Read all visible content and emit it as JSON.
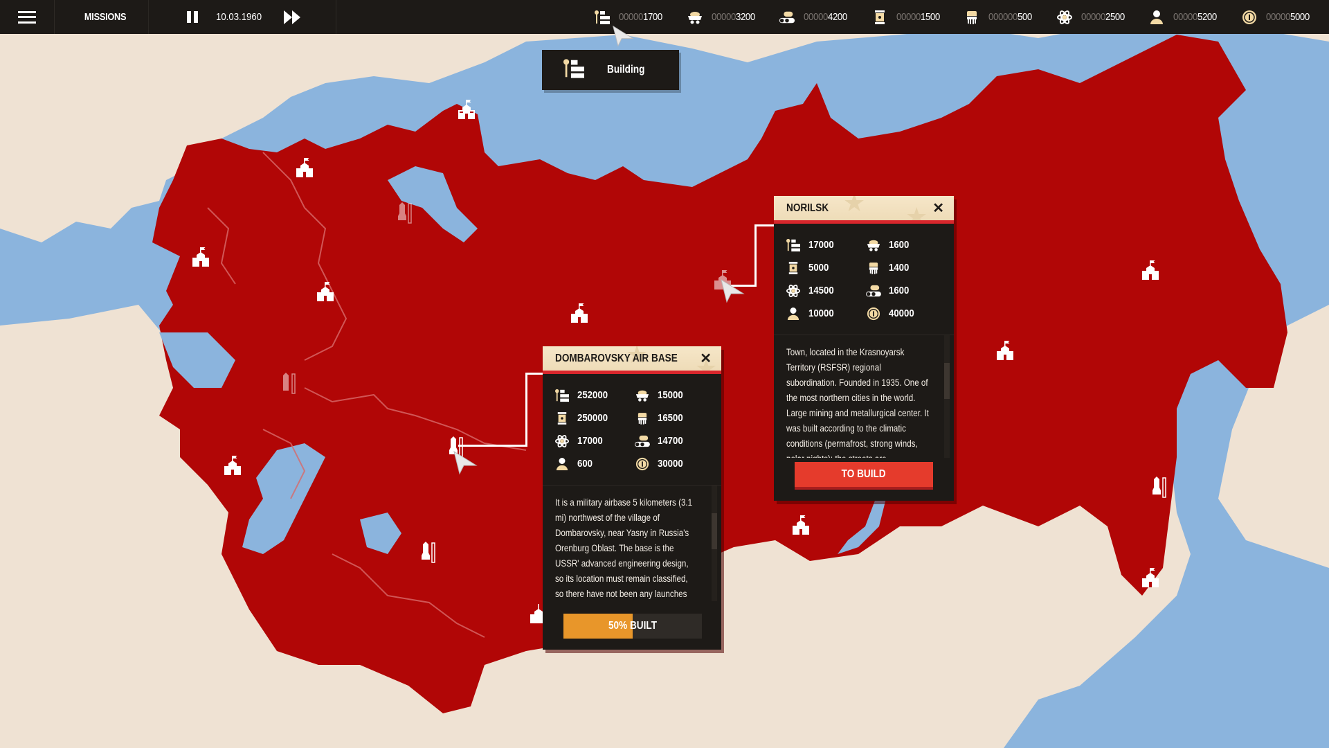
{
  "topbar": {
    "menu_icon": "hamburger-icon",
    "missions_label": "MISSIONS",
    "pause_icon": "pause-icon",
    "date": "10.03.1960",
    "fast_forward_icon": "fast-forward-icon"
  },
  "resources": [
    {
      "icon": "building-icon",
      "pad": "00000",
      "value": "1700"
    },
    {
      "icon": "ore-cart-icon",
      "pad": "00000",
      "value": "3200"
    },
    {
      "icon": "timber-icon",
      "pad": "00000",
      "value": "4200"
    },
    {
      "icon": "fuel-barrel-icon",
      "pad": "00000",
      "value": "1500"
    },
    {
      "icon": "engine-icon",
      "pad": "000000",
      "value": "500"
    },
    {
      "icon": "atom-icon",
      "pad": "00000",
      "value": "2500"
    },
    {
      "icon": "population-icon",
      "pad": "00000",
      "value": "5200"
    },
    {
      "icon": "coin-icon",
      "pad": "00000",
      "value": "5000"
    }
  ],
  "building_tooltip": {
    "icon": "building-icon",
    "label": "Building"
  },
  "dombarovsky": {
    "title": "DOMBAROVSKY AIR BASE",
    "close": "✕",
    "stats": [
      {
        "icon": "building-icon",
        "value": "252000"
      },
      {
        "icon": "ore-cart-icon",
        "value": "15000"
      },
      {
        "icon": "fuel-barrel-icon",
        "value": "250000"
      },
      {
        "icon": "engine-icon",
        "value": "16500"
      },
      {
        "icon": "atom-icon",
        "value": "17000"
      },
      {
        "icon": "timber-icon",
        "value": "14700"
      },
      {
        "icon": "population-icon",
        "value": "600"
      },
      {
        "icon": "coin-icon",
        "value": "30000"
      }
    ],
    "description": "It is a military airbase 5 kilometers (3.1 mi) northwest of the village of Dombarovsky, near Yasny in Russia's Orenburg Oblast. The base is the USSR' advanced engineering design, so its location must remain classified, so there have not been any launches from it yet.",
    "progress_percent": 50,
    "progress_label": "50% BUILT"
  },
  "norilsk": {
    "title": "NORILSK",
    "close": "✕",
    "stats": [
      {
        "icon": "building-icon",
        "value": "17000"
      },
      {
        "icon": "ore-cart-icon",
        "value": "1600"
      },
      {
        "icon": "fuel-barrel-icon",
        "value": "5000"
      },
      {
        "icon": "engine-icon",
        "value": "1400"
      },
      {
        "icon": "atom-icon",
        "value": "14500"
      },
      {
        "icon": "timber-icon",
        "value": "1600"
      },
      {
        "icon": "population-icon",
        "value": "10000"
      },
      {
        "icon": "coin-icon",
        "value": "40000"
      }
    ],
    "description": "Town, located in the Krasnoyarsk Territory (RSFSR) regional subordination. Founded in 1935. One of the most northern cities in the world. Large mining and metallurgical center. It was built according to the climatic conditions (permafrost, strong winds, polar nights): the streets are perpendicular to the wind direction, also",
    "build_label": "TO BUILD"
  },
  "colors": {
    "territory": "#b10606",
    "water": "#8bb4dd",
    "land": "#efe2d3",
    "panel": "#1d1a17",
    "header": "#f2e2c2",
    "accent_red": "#e53b2c",
    "progress": "#e8962a",
    "icon_cream": "#f2d9a4"
  }
}
